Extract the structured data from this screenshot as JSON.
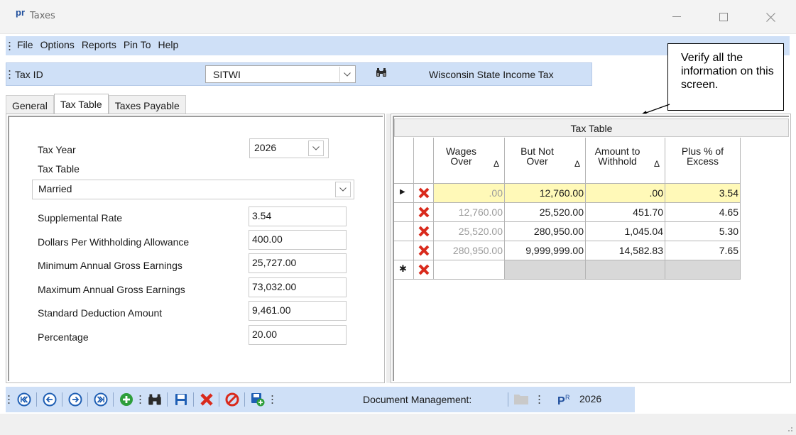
{
  "window": {
    "logo": "pr",
    "title": "Taxes"
  },
  "menu": {
    "items": [
      "File",
      "Options",
      "Reports",
      "Pin To",
      "Help"
    ]
  },
  "taxid": {
    "label": "Tax ID",
    "value": "SITWI",
    "description": "Wisconsin State Income Tax"
  },
  "callout": {
    "text": "Verify all the information on this screen."
  },
  "tabs": [
    "General",
    "Tax Table",
    "Taxes Payable"
  ],
  "form": {
    "tax_year_label": "Tax Year",
    "tax_year_value": "2026",
    "tax_table_label": "Tax Table",
    "tax_table_value": "Married",
    "supplemental_rate_label": "Supplemental Rate",
    "supplemental_rate_value": "3.54",
    "dollars_per_allowance_label": "Dollars Per Withholding Allowance",
    "dollars_per_allowance_value": "400.00",
    "min_gross_label": "Minimum Annual Gross Earnings",
    "min_gross_value": "25,727.00",
    "max_gross_label": "Maximum Annual Gross Earnings",
    "max_gross_value": "73,032.00",
    "std_deduction_label": "Standard Deduction Amount",
    "std_deduction_value": "9,461.00",
    "percentage_label": "Percentage",
    "percentage_value": "20.00"
  },
  "grid": {
    "title": "Tax Table",
    "headers": {
      "wages_over_1": "Wages",
      "wages_over_2": "Over",
      "but_not_over_1": "But Not",
      "but_not_over_2": "Over",
      "amount_1": "Amount to",
      "amount_2": "Withhold",
      "plus_1": "Plus % of",
      "plus_2": "Excess"
    },
    "sort_glyph": "Δ",
    "rows": [
      {
        "wages_over": ".00",
        "but_not_over": "12,760.00",
        "amount": ".00",
        "plus": "3.54"
      },
      {
        "wages_over": "12,760.00",
        "but_not_over": "25,520.00",
        "amount": "451.70",
        "plus": "4.65"
      },
      {
        "wages_over": "25,520.00",
        "but_not_over": "280,950.00",
        "amount": "1,045.04",
        "plus": "5.30"
      },
      {
        "wages_over": "280,950.00",
        "but_not_over": "9,999,999.00",
        "amount": "14,582.83",
        "plus": "7.65"
      }
    ],
    "current_row_glyph": "▶",
    "new_row_glyph": "✱"
  },
  "bottom": {
    "doc_mgmt_label": "Document Management:",
    "year": "2026"
  },
  "colors": {
    "toolbar_blue": "#cfe0f7",
    "delete_red": "#d92a1c",
    "highlight_yellow": "#fff9b8"
  }
}
